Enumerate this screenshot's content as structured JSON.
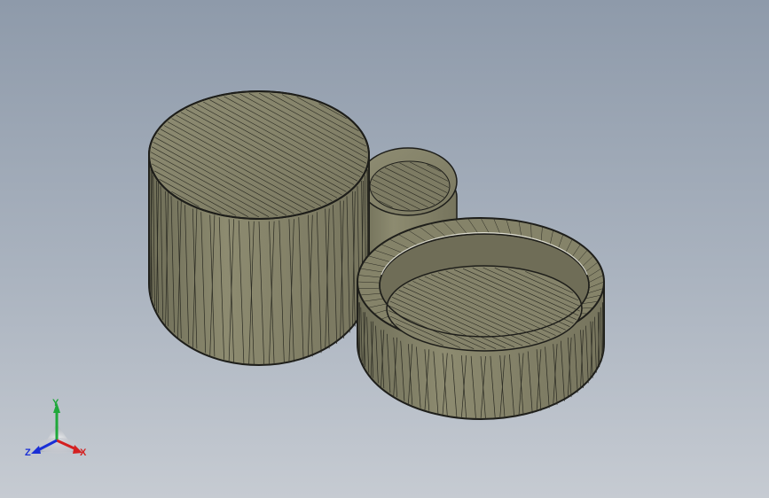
{
  "viewport": {
    "background_top": "#8e9aaa",
    "background_bottom": "#c6cbd2",
    "model_color": "#828066",
    "edge_color": "#1e1e1a"
  },
  "model": {
    "parts": [
      "tall-solid-cylinder",
      "small-rear-cap",
      "open-front-cup"
    ]
  },
  "triad": {
    "x_label": "X",
    "y_label": "Y",
    "z_label": "Z",
    "x_color": "#d42020",
    "y_color": "#1fa83a",
    "z_color": "#1a2fd6"
  }
}
